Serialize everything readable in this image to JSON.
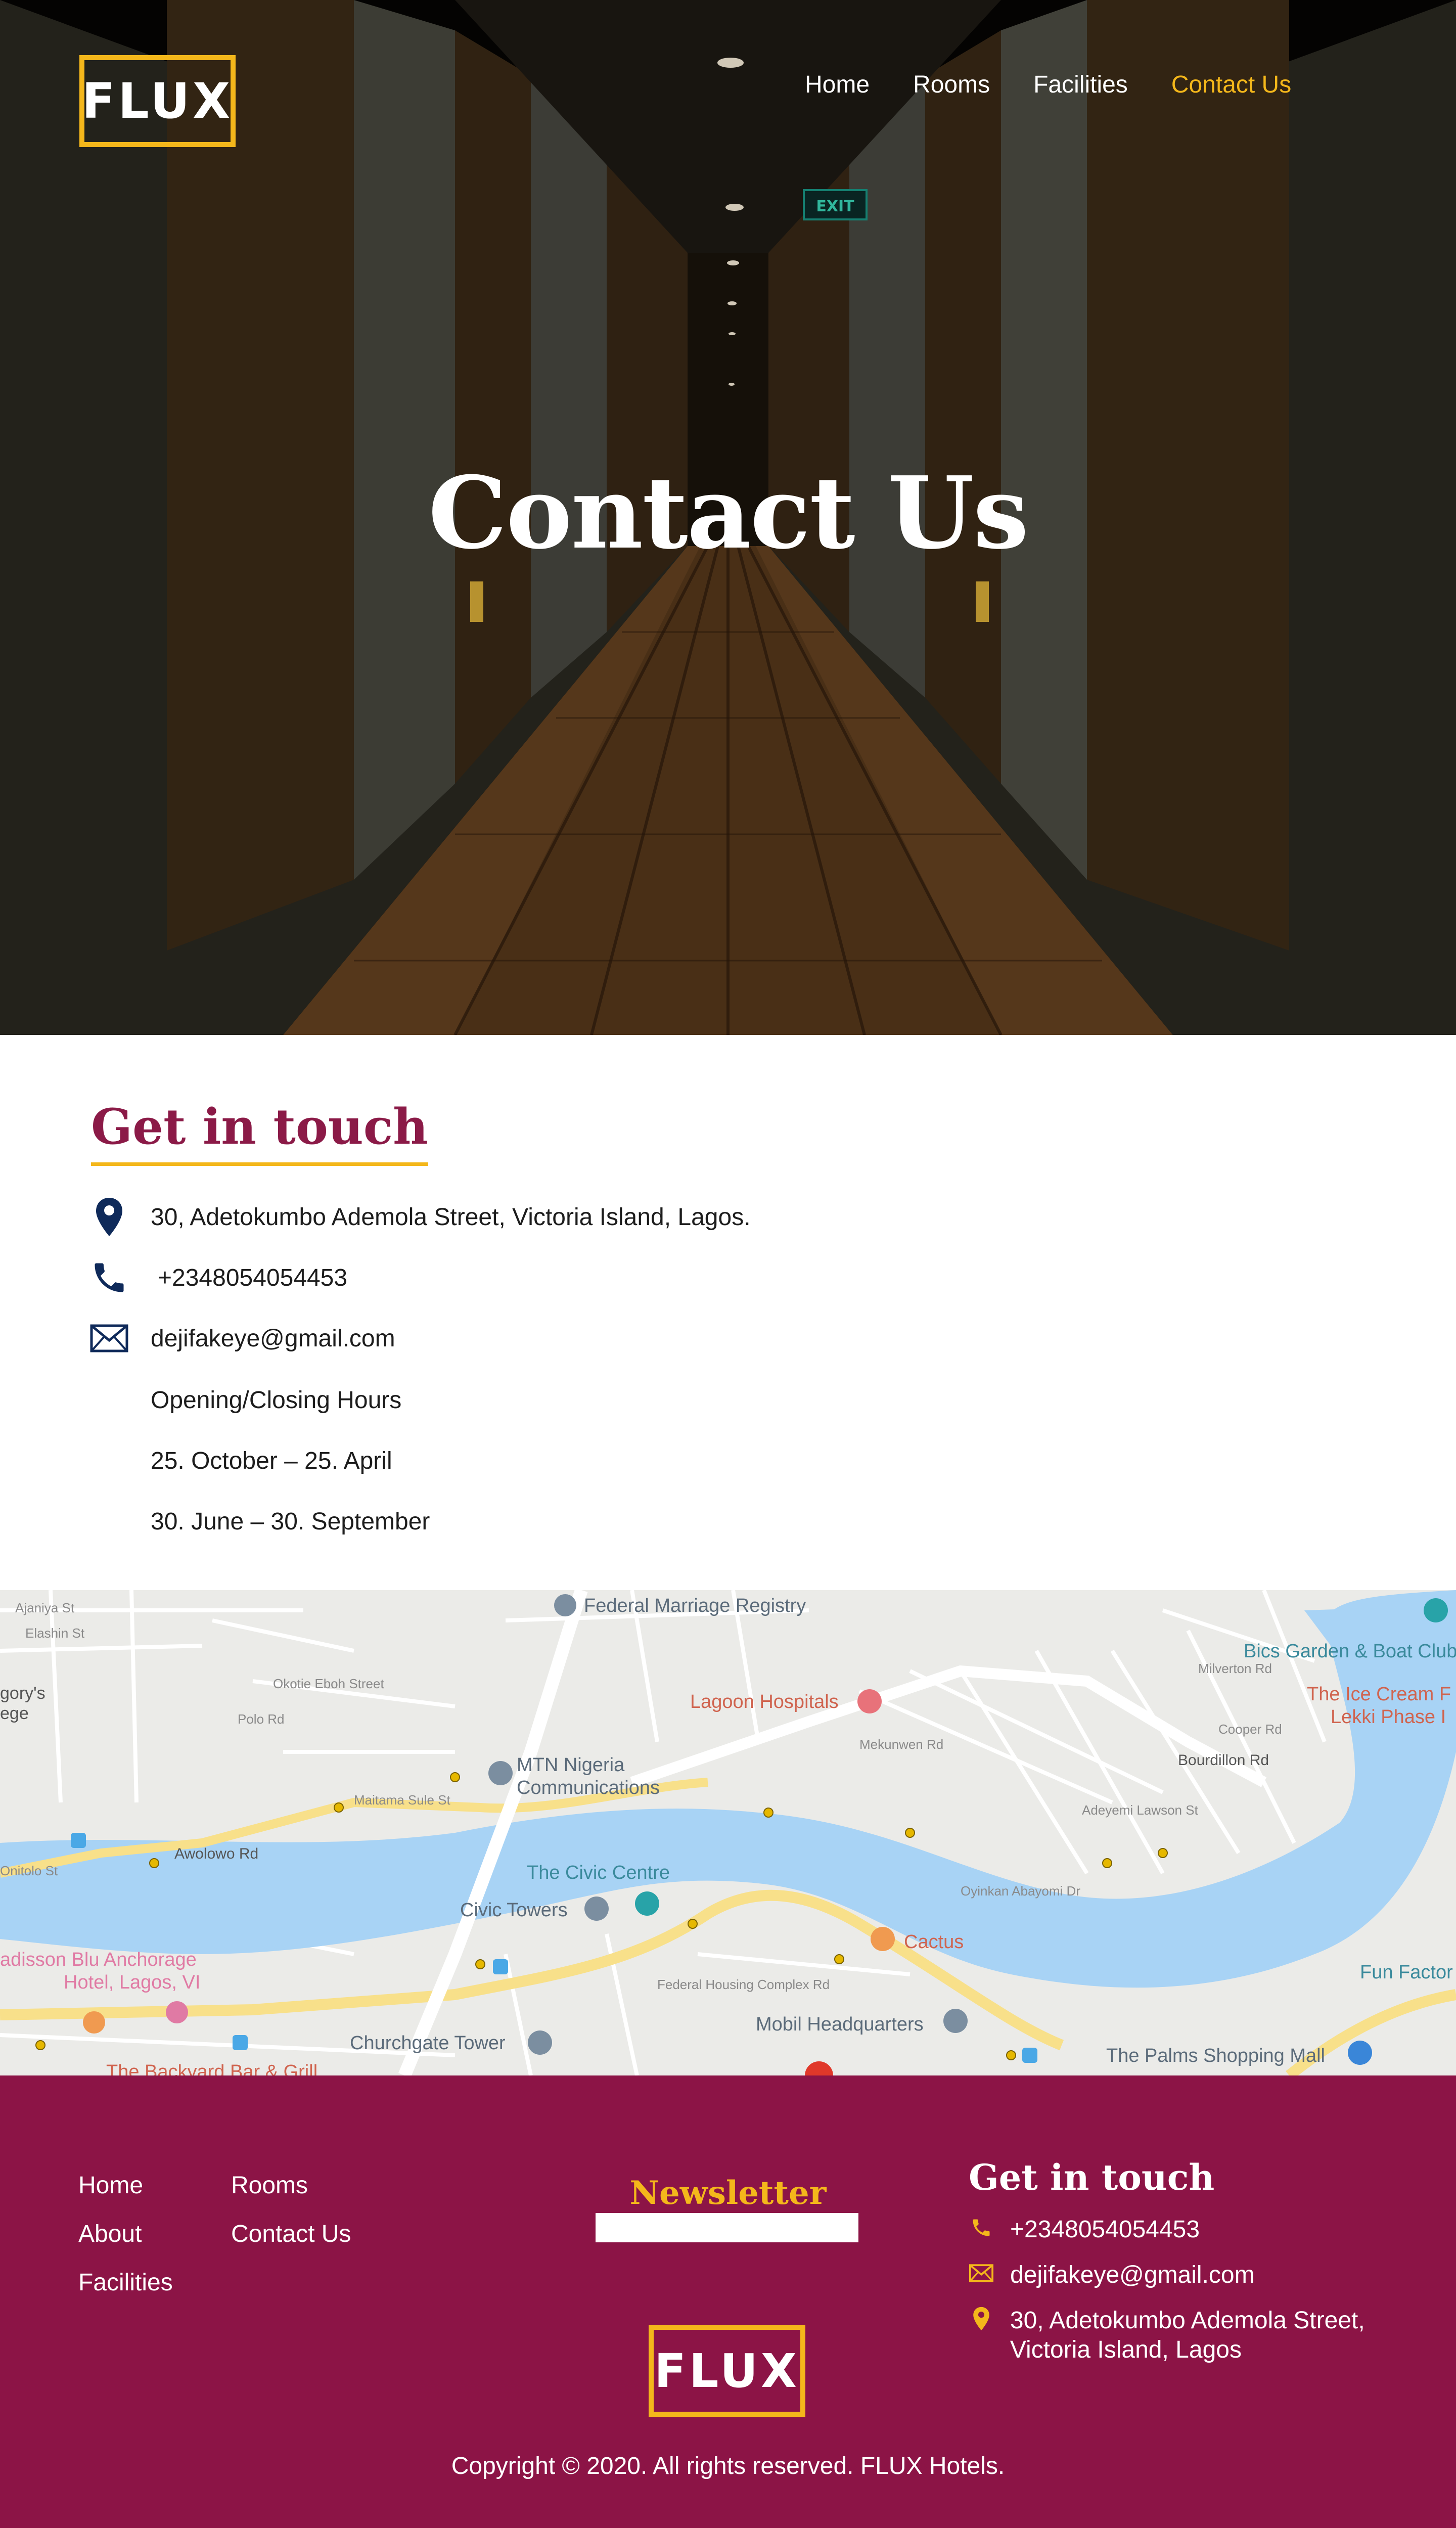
{
  "header": {
    "logo_text": "FLUX",
    "nav": [
      {
        "label": "Home"
      },
      {
        "label": "Rooms"
      },
      {
        "label": "Facilities"
      },
      {
        "label": "Contact Us"
      }
    ],
    "active_nav": "Contact Us",
    "hero_title": "Contact Us",
    "exit_sign": "EXIT"
  },
  "contact": {
    "heading": "Get in touch",
    "address": "30, Adetokumbo Ademola Street, Victoria Island, Lagos.",
    "phone": "+2348054054453",
    "email": "dejifakeye@gmail.com",
    "hours_label": "Opening/Closing Hours",
    "hours": [
      "25. October  – 25. April",
      "30. June  – 30. September"
    ]
  },
  "map": {
    "labels": {
      "federal_marriage": "Federal Marriage Registry",
      "bics": "Bics Garden & Boat Club",
      "ice_cream": "The Ice Cream F",
      "lekki": "Lekki Phase I",
      "lagoon": "Lagoon Hospitals",
      "mtn": "MTN Nigeria",
      "mtn2": "Communications",
      "civic_centre": "The Civic Centre",
      "civic_towers": "Civic Towers",
      "cactus": "Cactus",
      "radisson": "adisson Blu Anchorage",
      "radisson2": "Hotel, Lagos, VI",
      "churchgate": "Churchgate Tower",
      "mobil": "Mobil Headquarters",
      "palms": "The Palms Shopping Mall",
      "fun": "Fun Factor",
      "backyard": "The Backyard Bar & Grill",
      "gory": "gory's",
      "ege": "ege",
      "awolowo": "Awolowo Rd",
      "bourdillon": "Bourdillon Rd",
      "mekunwen": "Mekunwen Rd",
      "okotie": "Okotie Eboh Street",
      "polo": "Polo Rd",
      "milverton": "Milverton Rd",
      "cooper": "Cooper Rd",
      "maitama": "Maitama Sule St",
      "adeyemi": "Adeyemi Lawson St",
      "oyinkan": "Oyinkan Abayomi Dr",
      "federal_housing": "Federal Housing Complex Rd",
      "ajaniya": "Ajaniya St",
      "elashin": "Elashin St",
      "onitolo": "Onitolo St"
    }
  },
  "footer": {
    "links_col1": [
      "Home",
      "About",
      "Facilities"
    ],
    "links_col2": [
      "Rooms",
      "Contact Us"
    ],
    "newsletter_title": "Newsletter",
    "newsletter_placeholder": "",
    "git_heading": "Get in touch",
    "phone": "+2348054054453",
    "email": "dejifakeye@gmail.com",
    "address": "30, Adetokumbo Ademola Street, Victoria Island, Lagos",
    "logo_text": "FLUX",
    "copyright": "Copyright © 2020. All rights reserved. FLUX Hotels."
  },
  "colors": {
    "accent_yellow": "#f4b71b",
    "brand_maroon": "#8c1446",
    "heading_maroon": "#8b1a47",
    "icon_navy": "#0f2a5a",
    "water": "#a8d3f5",
    "major_road": "#f8e08a"
  },
  "icons": [
    "location-pin-icon",
    "phone-icon",
    "envelope-icon"
  ]
}
